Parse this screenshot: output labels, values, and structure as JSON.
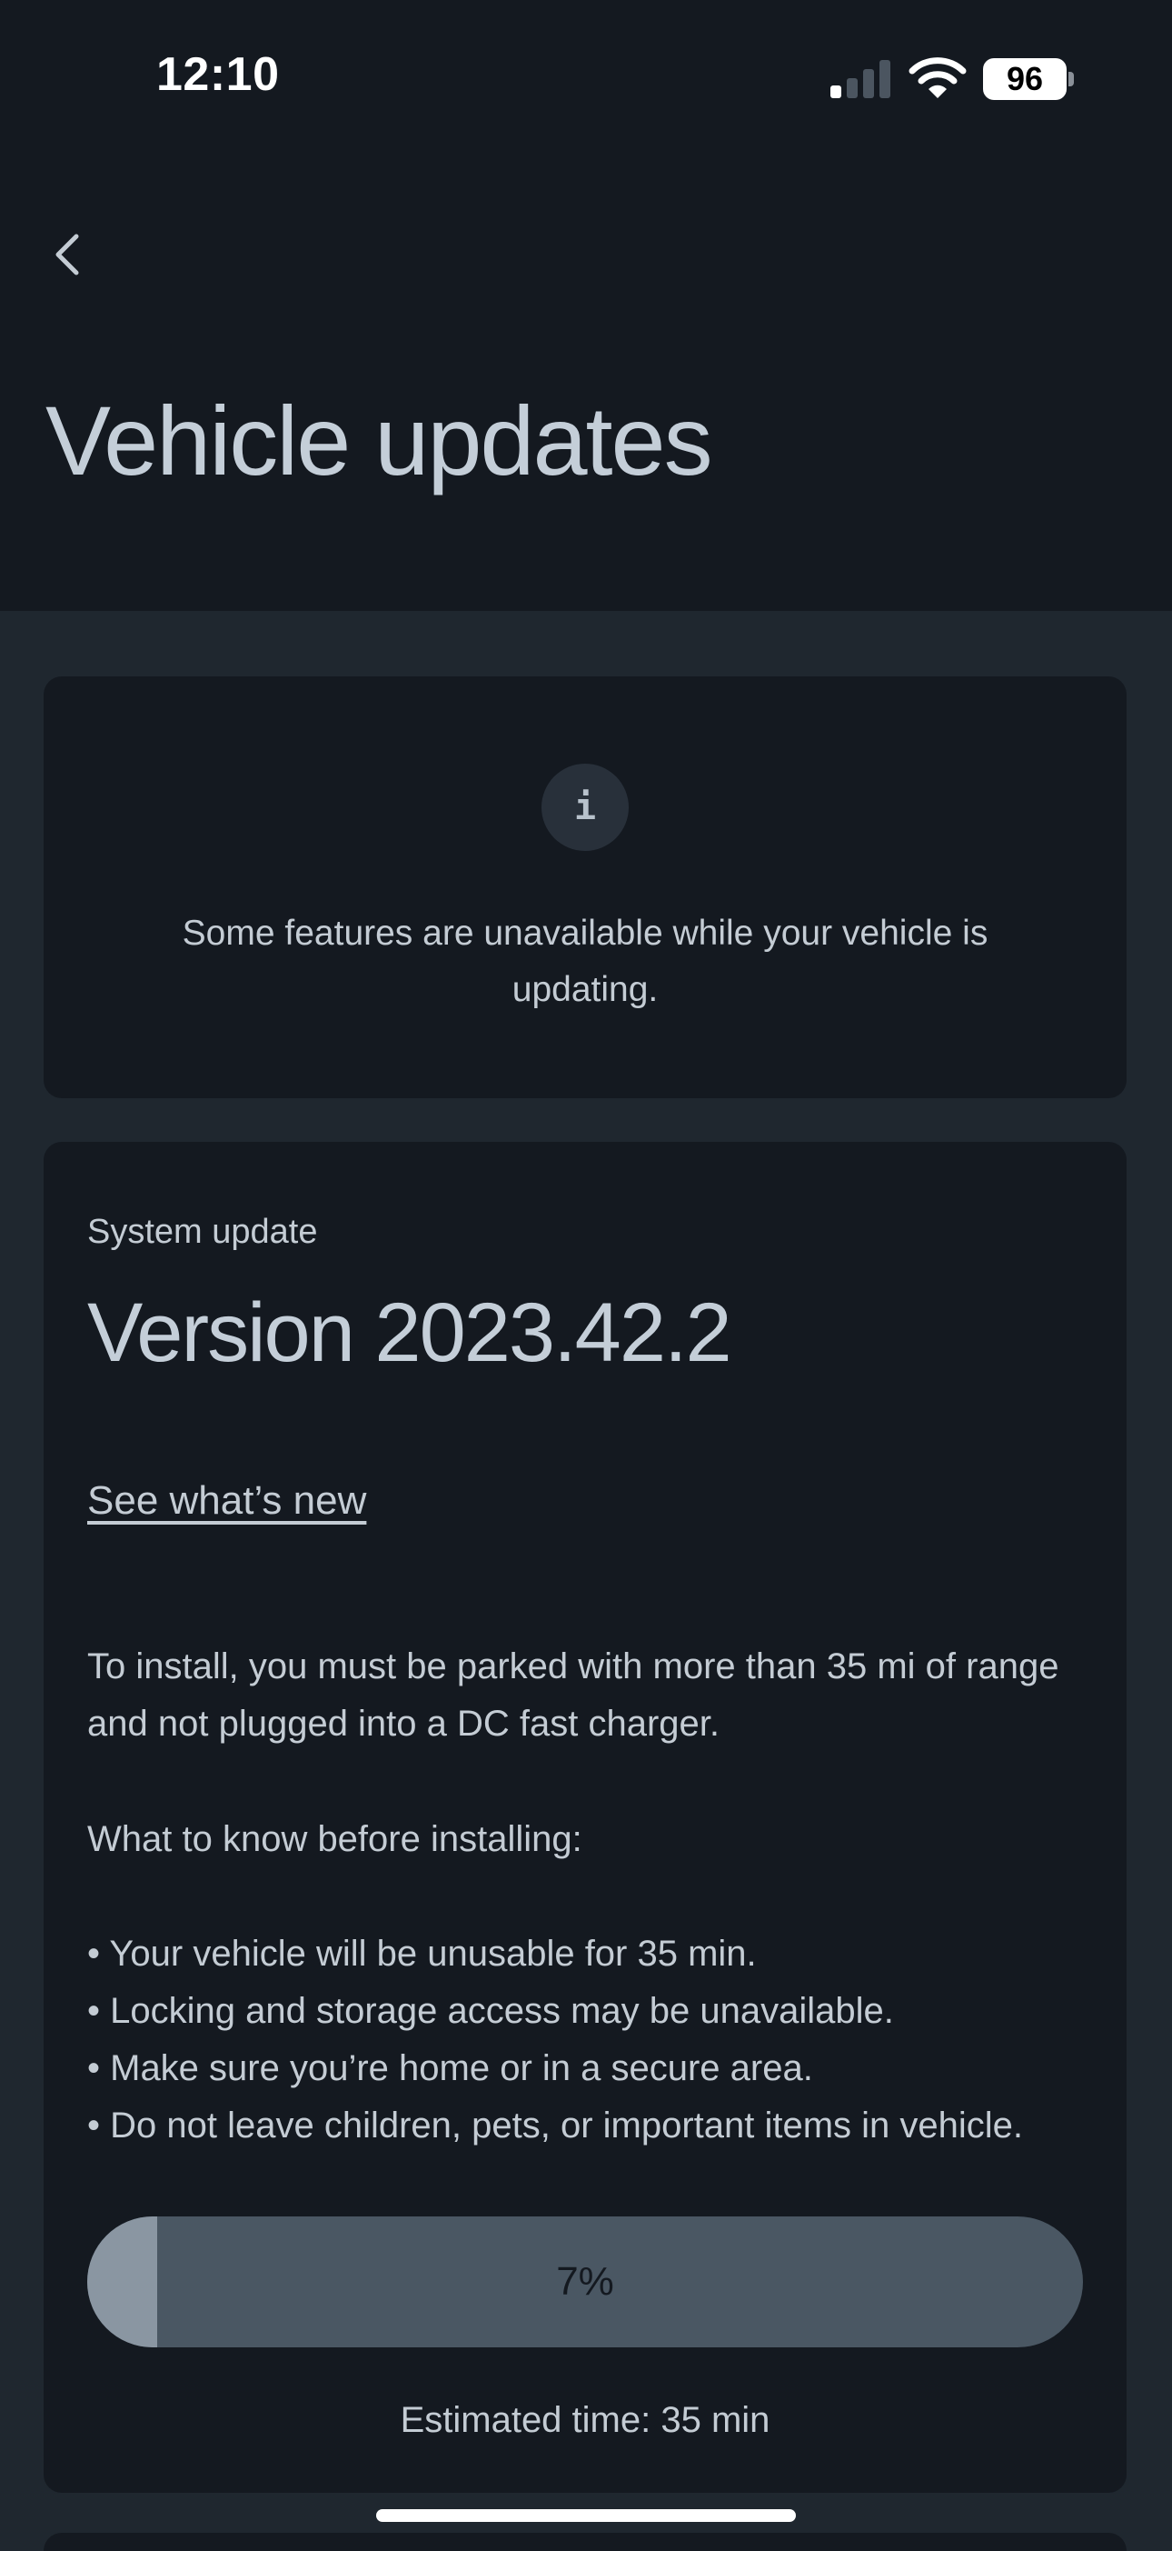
{
  "status_bar": {
    "time": "12:10",
    "battery": "96",
    "icons": [
      "cellular-signal-icon",
      "wifi-icon",
      "battery-icon"
    ]
  },
  "header": {
    "back_icon": "chevron-left-icon",
    "title": "Vehicle updates"
  },
  "info_card": {
    "icon": "info-icon",
    "icon_glyph": "i",
    "message": "Some features are unavailable while your vehicle is updating."
  },
  "update": {
    "kicker": "System update",
    "version": "Version 2023.42.2",
    "whats_new_link": "See what’s new",
    "requirements": "To install, you must be parked with more than 35 mi of range and not plugged into a DC fast charger.",
    "know_heading": "What to know before installing:",
    "bullets": [
      "• Your vehicle will be unusable for 35 min.",
      "• Locking and storage access may be unavailable.",
      "• Make sure you’re home or in a secure area.",
      "• Do not leave children, pets, or important items in vehicle."
    ],
    "progress_percent": 7,
    "progress_label": "7%",
    "estimated_time": "Estimated time: 35 min"
  },
  "colors": {
    "background": "#1f272f",
    "card": "#141920",
    "text": "#c4ccd4",
    "progress_track": "#4a5763",
    "progress_fill": "#8a96a2"
  }
}
